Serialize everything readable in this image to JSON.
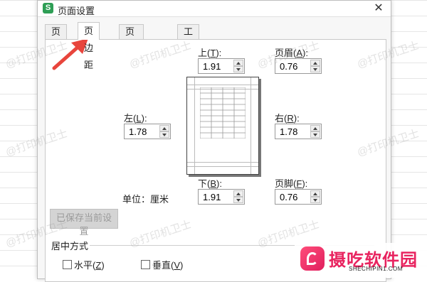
{
  "window": {
    "title": "页面设置",
    "app_icon_letter": "S",
    "close_glyph": "✕"
  },
  "tabs": [
    {
      "label": "页面"
    },
    {
      "label": "页边距",
      "active": true
    },
    {
      "label": "页眉/页脚"
    },
    {
      "label": "工作表"
    }
  ],
  "margins": {
    "top": {
      "label": "上",
      "hotkey": "T",
      "suffix": ":",
      "value": "1.91"
    },
    "header": {
      "label": "页眉",
      "hotkey": "A",
      "suffix": ":",
      "value": "0.76"
    },
    "left": {
      "label": "左",
      "hotkey": "L",
      "suffix": ":",
      "value": "1.78"
    },
    "right": {
      "label": "右",
      "hotkey": "R",
      "suffix": ":",
      "value": "1.78"
    },
    "bottom": {
      "label": "下",
      "hotkey": "B",
      "suffix": ":",
      "value": "1.91"
    },
    "footer": {
      "label": "页脚",
      "hotkey": "F",
      "suffix": ":",
      "value": "0.76"
    }
  },
  "unit_label": "单位：厘米",
  "save_button": "已保存当前设置",
  "centering": {
    "title": "居中方式",
    "horizontal": {
      "label": "水平",
      "hotkey": "Z"
    },
    "vertical": {
      "label": "垂直",
      "hotkey": "V"
    }
  },
  "watermark_text": "@打印机卫士",
  "brand": {
    "name": "摄吃软件园",
    "url": "SHECHIPIN1.COM"
  },
  "colors": {
    "arrow": "#e8453c",
    "brand": "#e8235f",
    "app_icon": "#2e9e55"
  }
}
